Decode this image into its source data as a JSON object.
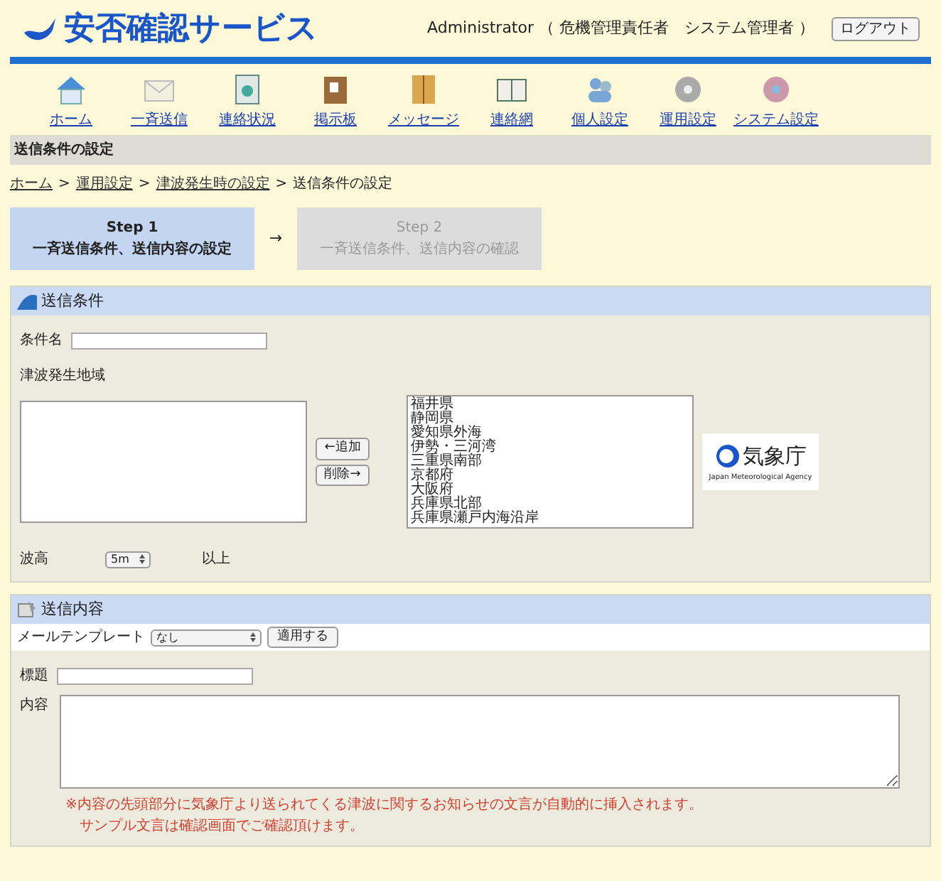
{
  "header": {
    "logo": "安否確認サービス",
    "user": "Administrator （ 危機管理責任者　システム管理者 ）",
    "logout": "ログアウト"
  },
  "nav": [
    {
      "label": "ホーム"
    },
    {
      "label": "一斉送信"
    },
    {
      "label": "連絡状況"
    },
    {
      "label": "掲示板"
    },
    {
      "label": "メッセージ"
    },
    {
      "label": "連絡網"
    },
    {
      "label": "個人設定"
    },
    {
      "label": "運用設定"
    },
    {
      "label": "システム設定"
    }
  ],
  "page_title": "送信条件の設定",
  "breadcrumb": [
    {
      "label": "ホーム",
      "link": true
    },
    {
      "label": "運用設定",
      "link": true
    },
    {
      "label": "津波発生時の設定",
      "link": true
    },
    {
      "label": "送信条件の設定",
      "link": false
    }
  ],
  "breadcrumb_separator": ">",
  "steps": [
    {
      "title": "Step 1",
      "subtitle": "一斉送信条件、送信内容の設定",
      "selected": true
    },
    {
      "title": "Step 2",
      "subtitle": "一斉送信条件、送信内容の確認",
      "selected": false
    }
  ],
  "step_arrow": "→",
  "conditions": {
    "title": "送信条件",
    "name_label": "条件名",
    "region_label": "津波発生地域",
    "add_button": "←追加",
    "remove_button": "削除→",
    "regions": [
      "福井県",
      "静岡県",
      "愛知県外海",
      "伊勢・三河湾",
      "三重県南部",
      "京都府",
      "大阪府",
      "兵庫県北部",
      "兵庫県瀬戸内海沿岸"
    ],
    "agency_logo": {
      "name": "気象庁",
      "subtitle": "Japan Meteorological Agency"
    },
    "wave_label": "波高",
    "wave_value": "5m",
    "wave_suffix": "以上"
  },
  "content": {
    "title": "送信内容",
    "template_label": "メールテンプレート",
    "template_value": "なし",
    "apply_button": "適用する",
    "subject_label": "標題",
    "body_label": "内容",
    "notes": [
      "※内容の先頭部分に気象庁より送られてくる津波に関するお知らせの文言が自動的に挿入されます。",
      "サンプル文言は確認画面でご確認頂けます。"
    ]
  }
}
